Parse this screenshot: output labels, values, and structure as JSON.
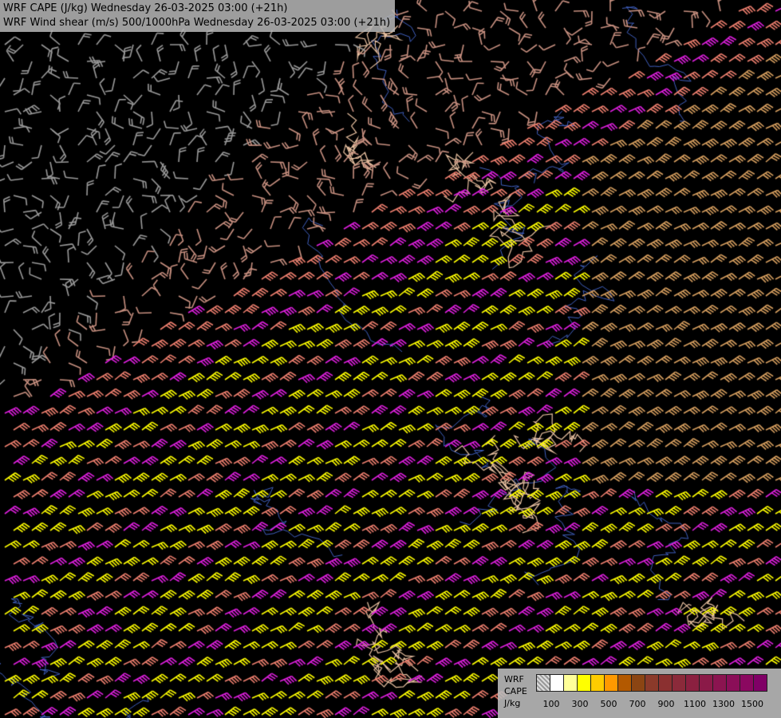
{
  "title": {
    "line1": "WRF CAPE (J/kg) Wednesday 26-03-2025 03:00 (+21h)",
    "line2": "WRF Wind shear (m/s) 500/1000hPa Wednesday 26-03-2025 03:00 (+21h)"
  },
  "legend": {
    "line1": "WRF",
    "line2": "CAPE",
    "line3": "J/kg",
    "swatch_colors": [
      "#a0a0a0",
      "#ffffff",
      "#ffff99",
      "#ffff00",
      "#ffcc00",
      "#ff9900",
      "#b35900",
      "#8b4513",
      "#8b3a2a",
      "#8b3030",
      "#8b2a3a",
      "#8b2040",
      "#8b1a48",
      "#8b1450",
      "#8b0e58",
      "#8b0860",
      "#800066"
    ],
    "tick_labels": [
      "100",
      "300",
      "500",
      "700",
      "900",
      "1100",
      "1300",
      "1500"
    ]
  },
  "colors": {
    "background": "#000000",
    "barb_low": "#9a9a9a",
    "barb_mid": "#c89080",
    "barb_salmon": "#f08070",
    "barb_yellow": "#ffff00",
    "barb_magenta": "#e020e0",
    "barb_tan": "#d8a060",
    "border": "#e8c0a0",
    "river": "#4060c0"
  },
  "icons": [
    "wind-barb-icon"
  ]
}
